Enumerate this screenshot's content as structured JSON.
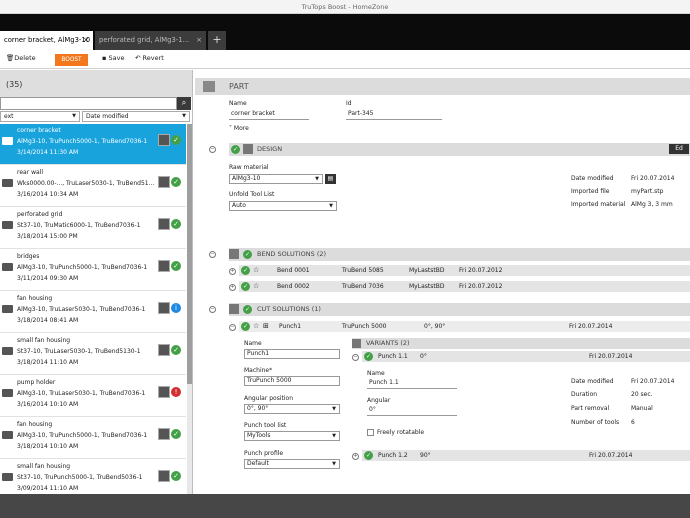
{
  "window": {
    "title": "TruTops Boost - HomeZone"
  },
  "tabs": [
    {
      "label": "corner bracket, AlMg3-10",
      "active": true
    },
    {
      "label": "perforated grid, AlMg3-1...",
      "active": false
    }
  ],
  "toolbar": {
    "delete_label": "Delete",
    "boost_label": "BOOST",
    "save_label": "Save",
    "revert_label": "Revert"
  },
  "left": {
    "count": "(35)",
    "search_value": "",
    "sort_field": "ext",
    "sort_order": "Date modified",
    "items": [
      {
        "name": "corner bracket",
        "detail": "AlMg3-10, TruPunch5000-1, TruBend7036-1",
        "date": "3/14/2014 11:30 AM",
        "status": "ok",
        "selected": true
      },
      {
        "name": "rear wall",
        "detail": "Wks0000.00-..., TruLaser5030-1, TruBend51...",
        "date": "3/16/2014 10:34 AM",
        "status": "ok",
        "selected": false
      },
      {
        "name": "perforated grid",
        "detail": "St37-10, TruMatic6000-1, TruBend7036-1",
        "date": "3/18/2014 15:00 PM",
        "status": "ok",
        "selected": false
      },
      {
        "name": "bridges",
        "detail": "AlMg3-10, TruPunch5000-1, TruBend7036-1",
        "date": "3/11/2014 09:30 AM",
        "status": "ok",
        "selected": false
      },
      {
        "name": "fan housing",
        "detail": "AlMg3-10, TruLaser5030-1, TruBend7036-1",
        "date": "3/18/2014 08:41 AM",
        "status": "info",
        "selected": false
      },
      {
        "name": "small fan housing",
        "detail": "St37-10, TruLaser5030-1, TruBend5130-1",
        "date": "3/18/2014 11:10 AM",
        "status": "ok",
        "selected": false
      },
      {
        "name": "pump holder",
        "detail": "AlMg3-10, TruLaser5030-1, TruBend7036-1",
        "date": "3/16/2014 10:10 AM",
        "status": "err",
        "selected": false
      },
      {
        "name": "fan housing",
        "detail": "AlMg3-10, TruPunch5000-1, TruBend7036-1",
        "date": "3/18/2014 10:10 AM",
        "status": "ok",
        "selected": false
      },
      {
        "name": "small fan housing",
        "detail": "St37-10, TruPunch5000-1, TruBend5036-1",
        "date": "3/09/2014 11:10 AM",
        "status": "ok",
        "selected": false
      }
    ]
  },
  "part": {
    "header": "PART",
    "name_label": "Name",
    "name_value": "corner bracket",
    "id_label": "Id",
    "id_value": "Part-345",
    "more_label": "More"
  },
  "design": {
    "header": "DESIGN",
    "button": "Ed",
    "raw_material_label": "Raw material",
    "raw_material_value": "AlMg3-10",
    "unfold_label": "Unfold Tool List",
    "unfold_value": "Auto",
    "date_modified_label": "Date modified",
    "date_modified_value": "Fri 20.07.2014",
    "imported_file_label": "Imported file",
    "imported_file_value": "myPart.stp",
    "imported_material_label": "Imported material",
    "imported_material_value": "AlMg 3, 3 mm"
  },
  "bend": {
    "header": "BEND SOLUTIONS (2)",
    "rows": [
      {
        "name": "Bend 0001",
        "machine": "TruBend 5085",
        "tool": "MyLaststBD",
        "date": "Fri 20.07.2012"
      },
      {
        "name": "Bend 0002",
        "machine": "TruBend 7036",
        "tool": "MyLaststBD",
        "date": "Fri 20.07.2012"
      }
    ]
  },
  "cut": {
    "header": "CUT SOLUTIONS (1)",
    "row": {
      "name": "Punch1",
      "machine": "TruPunch 5000",
      "angle": "0°, 90°",
      "date": "Fri 20.07.2014"
    },
    "name_label": "Name",
    "name_value": "Punch1",
    "machine_label": "Machine*",
    "machine_value": "TruPunch 5000",
    "angular_label": "Angular position",
    "angular_value": "0°, 90°",
    "punch_tool_label": "Punch tool list",
    "punch_tool_value": "MyTools",
    "punch_profile_label": "Punch profile",
    "punch_profile_value": "Default",
    "variants_header": "VARIANTS (2)",
    "variant1": {
      "name": "Punch 1.1",
      "angle": "0°",
      "date": "Fri 20.07.2014"
    },
    "v_name_label": "Name",
    "v_name_value": "Punch 1.1",
    "v_angular_label": "Angular",
    "v_angular_value": "0°",
    "freely_rotatable_label": "Freely rotatable",
    "v_date_modified_label": "Date modified",
    "v_date_modified_value": "Fri 20.07.2014",
    "duration_label": "Duration",
    "duration_value": "20 sec.",
    "part_removal_label": "Part removal",
    "part_removal_value": "Manual",
    "num_tools_label": "Number of tools",
    "num_tools_value": "6",
    "variant2": {
      "name": "Punch 1.2",
      "angle": "90°",
      "date": "Fri 20.07.2014"
    }
  }
}
